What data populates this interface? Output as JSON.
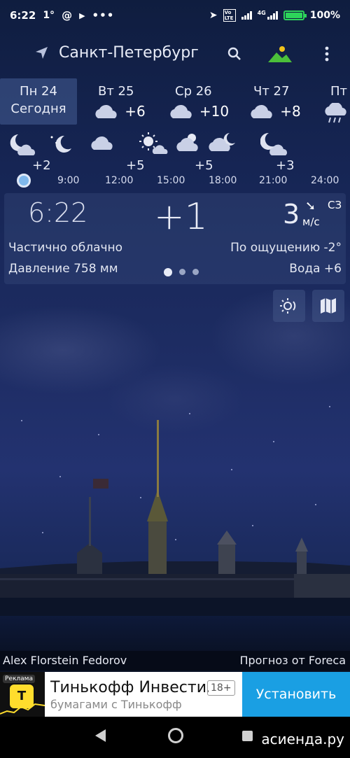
{
  "status_bar": {
    "time": "6:22",
    "temp": "1°",
    "icons": [
      "at-icon",
      "play-icon",
      "more-dots-icon"
    ],
    "network": "4G",
    "volte": "Vo LTE",
    "battery": "100%",
    "battery_level": 1.0,
    "battery_color": "#2dd45a"
  },
  "header": {
    "city": "Санкт-Петербург"
  },
  "days": [
    {
      "name": "Пн 24",
      "sub": "Сегодня",
      "temp": "",
      "icon": "",
      "selected": true
    },
    {
      "name": "Вт 25",
      "temp": "+6",
      "icon": "cloud-icon"
    },
    {
      "name": "Ср 26",
      "temp": "+10",
      "icon": "cloud-icon"
    },
    {
      "name": "Чт 27",
      "temp": "+8",
      "icon": "cloud-icon"
    },
    {
      "name": "Пт",
      "temp": "",
      "icon": "rain-cloud-icon"
    }
  ],
  "hourly": {
    "temps": [
      "+2",
      "+5",
      "+5",
      "+3"
    ],
    "times": [
      "9:00",
      "12:00",
      "15:00",
      "18:00",
      "21:00",
      "24:00"
    ],
    "icons": [
      "moon-cloud-icon",
      "moon-stars-icon",
      "cloud-icon",
      "sun-cloud-icon",
      "sun-cloud-icon",
      "cloud-icon",
      "moon-cloud-icon"
    ]
  },
  "current": {
    "time": "6:22",
    "temp": "+1",
    "wind_speed": "3",
    "wind_dir": "СЗ",
    "wind_unit": "м/с",
    "condition": "Частично облачно",
    "feels_like": "По ощущению -2°",
    "pressure": "Давление 758 мм",
    "water": "Вода +6"
  },
  "credits": {
    "photo_author": "Alex Florstein Fedorov",
    "provider": "Прогноз от Foreca"
  },
  "ad": {
    "badge": "Реклама",
    "title": "Тинькофф Инвести...",
    "subtitle": "бумагами с Тинькофф",
    "age": "18+",
    "button": "Установить",
    "button_color": "#1a9fe3"
  },
  "watermark": "асиенда.ру",
  "colors": {
    "today_highlight": "#465f96",
    "now_dot": "#7fb8ec"
  }
}
